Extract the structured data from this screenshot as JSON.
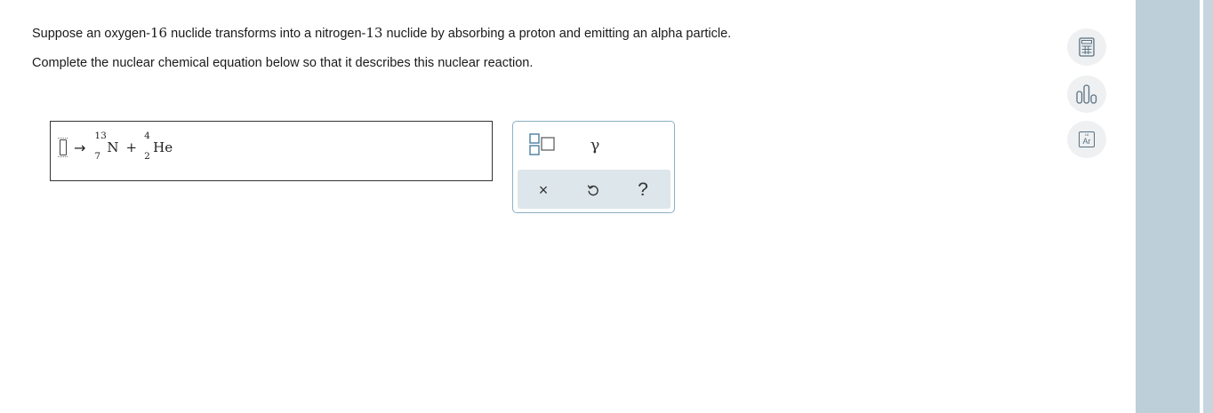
{
  "question": {
    "line1_pre": "Suppose an oxygen-",
    "line1_num1": "16",
    "line1_mid": " nuclide transforms into a nitrogen-",
    "line1_num2": "13",
    "line1_post": " nuclide by absorbing a proton and emitting an alpha particle.",
    "line2": "Complete the nuclear chemical equation below so that it describes this nuclear reaction."
  },
  "equation": {
    "arrow": "→",
    "product1": {
      "mass": "13",
      "atomic": "7",
      "symbol": "N"
    },
    "plus": "+",
    "product2": {
      "mass": "4",
      "atomic": "2",
      "symbol": "He"
    }
  },
  "palette": {
    "gamma_label": "γ",
    "clear_icon": "×",
    "help_label": "?"
  },
  "side_tools": {
    "periodic_table": {
      "atomic_number": "18",
      "symbol": "Ar"
    }
  },
  "colors": {
    "palette_border": "#8ab0c4",
    "palette_bottom": "#dde6ea",
    "icon_blue": "#5a7180",
    "right_panel": "#bdcfd8"
  }
}
